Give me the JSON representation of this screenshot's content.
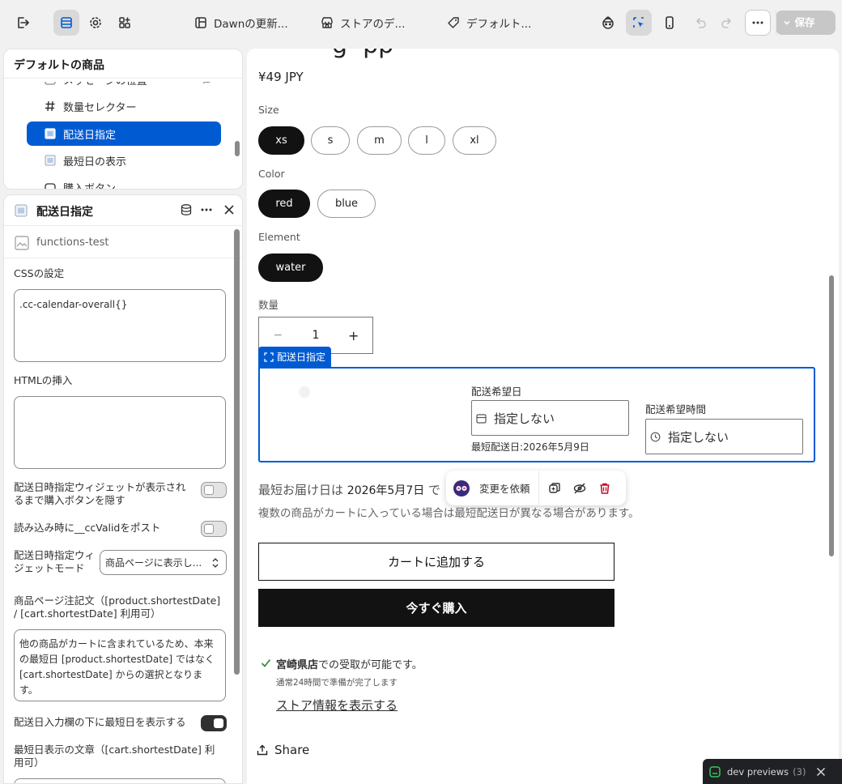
{
  "topbar": {
    "tabs": [
      {
        "label": "Dawnの更新..."
      },
      {
        "label": "ストアのデ..."
      },
      {
        "label": "デフォルト..."
      }
    ],
    "save_label": "保存"
  },
  "tree": {
    "title": "デフォルトの商品",
    "items": [
      {
        "label": "メッセージの位置"
      },
      {
        "label": "数量セレクター"
      },
      {
        "label": "配送日指定"
      },
      {
        "label": "最短日の表示"
      },
      {
        "label": "購入ボタン"
      }
    ]
  },
  "settings": {
    "title": "配送日指定",
    "app_name": "functions-test",
    "css_label": "CSSの設定",
    "css_value": ".cc-calendar-overall{}",
    "html_label": "HTMLの挿入",
    "html_value": "",
    "hide_buy_label": "配送日時指定ウィジェットが表示されるまで購入ボタンを隠す",
    "hide_buy_on": false,
    "post_valid_label": "読み込み時に__ccValidをポスト",
    "post_valid_on": false,
    "mode_label": "配送日時指定ウィジェットモード",
    "mode_value": "商品ページに表示し...",
    "note_label": "商品ページ注記文（[product.shortestDate] / [cart.shortestDate] 利用可）",
    "note_value": "他の商品がカートに含まれているため、本来の最短日 [product.shortestDate] ではなく [cart.shortestDate] からの選択となります。",
    "show_shortest_label": "配送日入力欄の下に最短日を表示する",
    "show_shortest_on": true,
    "shortest_text_label": "最短日表示の文章（[cart.shortestDate] 利用可）"
  },
  "preview": {
    "price": "¥49 JPY",
    "size_label": "Size",
    "sizes": [
      "xs",
      "s",
      "m",
      "l",
      "xl"
    ],
    "color_label": "Color",
    "colors": [
      "red",
      "blue"
    ],
    "element_label": "Element",
    "elements": [
      "water"
    ],
    "qty_label": "数量",
    "qty_minus": "−",
    "qty_value": "1",
    "qty_plus": "+",
    "block_tag": "配送日指定",
    "date_label": "配送希望日",
    "date_value": "指定しない",
    "time_label": "配送希望時間",
    "time_value": "指定しない",
    "shortest_note": "最短配送日:2026年5月9日",
    "earliest_prefix": "最短お届け日は",
    "earliest_date": "2026年5月7日",
    "earliest_suffix": "で",
    "multi_note": "複数の商品がカートに入っている場合は最短配送日が異なる場合があります。",
    "request_change": "変更を依頼",
    "add_to_cart": "カートに追加する",
    "buy_now": "今すぐ購入",
    "pickup_store": "宮崎県店",
    "pickup_text": "での受取が可能です。",
    "pickup_time": "通常24時間で準備が完了します",
    "store_link": "ストア情報を表示する",
    "share": "Share"
  },
  "dev_previews": {
    "label": "dev previews",
    "count": "(3)"
  },
  "colors": {
    "accent": "#005bd3",
    "primary_dark": "#121212",
    "delete_red": "#c70a24"
  }
}
